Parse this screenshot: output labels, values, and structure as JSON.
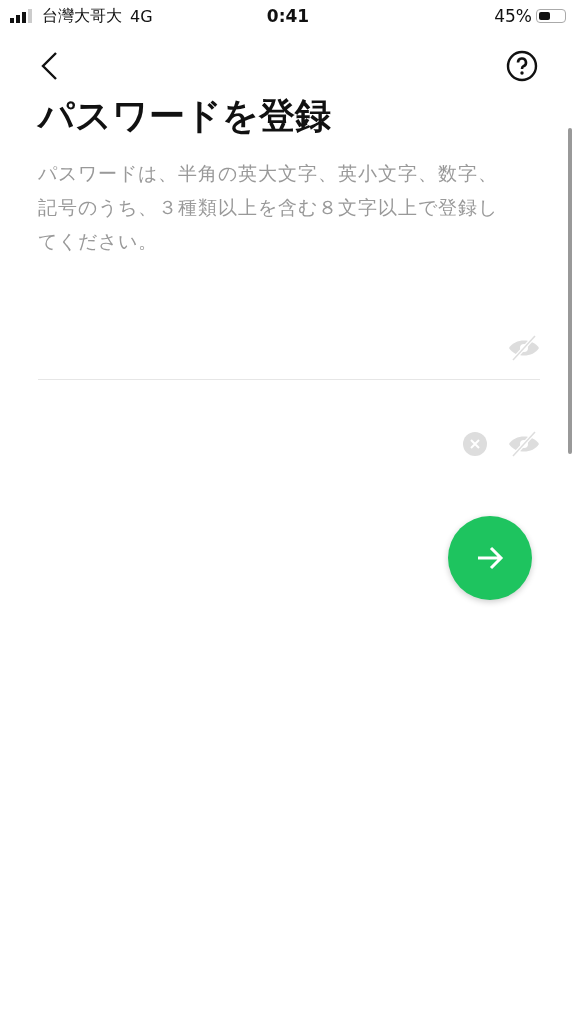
{
  "status_bar": {
    "carrier": "台灣大哥大",
    "network": "4G",
    "time": "0:41",
    "battery": "45%"
  },
  "title": "パスワードを登録",
  "description": "パスワードは、半角の英大文字、英小文字、数字、記号のうち、３種類以上を含む８文字以上で登録してください。",
  "fields": [
    {
      "clear_button": false,
      "divider": true
    },
    {
      "clear_button": true,
      "divider": false
    }
  ]
}
